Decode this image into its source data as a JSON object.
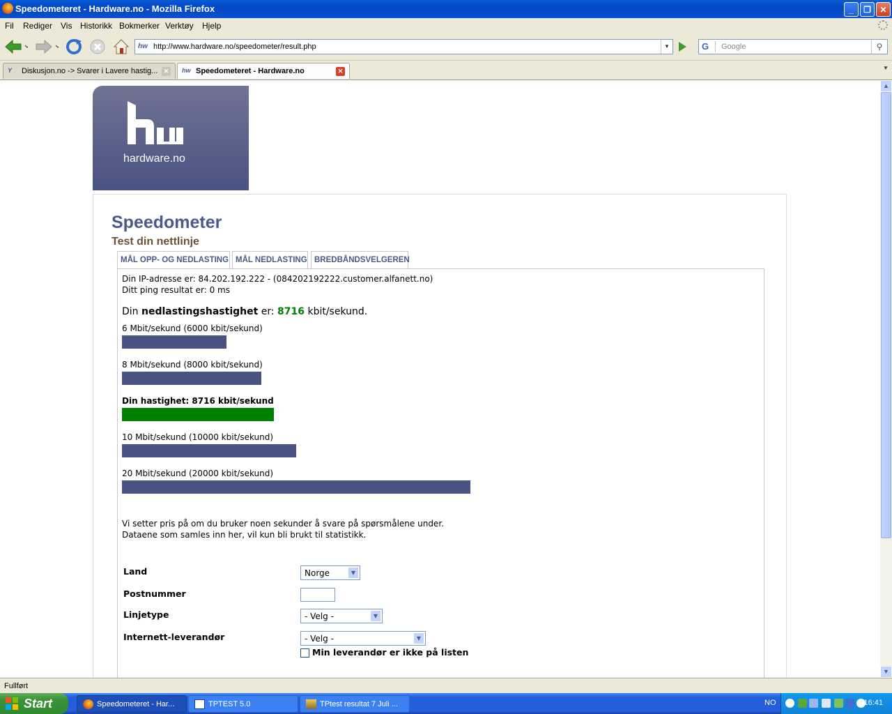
{
  "window": {
    "title": "Speedometeret - Hardware.no - Mozilla Firefox"
  },
  "menu": [
    "Fil",
    "Rediger",
    "Vis",
    "Historikk",
    "Bokmerker",
    "Verktøy",
    "Hjelp"
  ],
  "toolbar": {
    "url": "http://www.hardware.no/speedometer/result.php",
    "search_placeholder": "Google"
  },
  "tabs": [
    {
      "label": "Diskusjon.no -> Svarer i Lavere hastig...",
      "active": false
    },
    {
      "label": "Speedometeret - Hardware.no",
      "active": true
    }
  ],
  "page": {
    "logo_text": "hardware.no",
    "title": "Speedometer",
    "subtitle": "Test din nettlinje",
    "content_tabs": [
      "MÅL OPP- OG NEDLASTING",
      "MÅL NEDLASTING",
      "BREDBÅNDSVELGEREN"
    ],
    "ip_line": "Din IP-adresse er: 84.202.192.222 - (084202192222.customer.alfanett.no)",
    "ping_line": "Ditt ping resultat er: 0 ms",
    "speed_prefix": "Din ",
    "speed_bold": "nedlastingshastighet",
    "speed_mid": " er: ",
    "speed_value": "8716",
    "speed_suffix": " kbit/sekund.",
    "bars": [
      {
        "label": "6 Mbit/sekund (6000 kbit/sekund)",
        "kbit": 6000,
        "highlight": false
      },
      {
        "label": "8 Mbit/sekund (8000 kbit/sekund)",
        "kbit": 8000,
        "highlight": false
      },
      {
        "label": "Din hastighet: 8716 kbit/sekund",
        "kbit": 8716,
        "highlight": true
      },
      {
        "label": "10 Mbit/sekund (10000 kbit/sekund)",
        "kbit": 10000,
        "highlight": false
      },
      {
        "label": "20 Mbit/sekund (20000 kbit/sekund)",
        "kbit": 20000,
        "highlight": false
      }
    ],
    "survey_line1": "Vi setter pris på om du bruker noen sekunder å svare på spørsmålene under.",
    "survey_line2": "Dataene som samles inn her, vil kun bli brukt til statistikk.",
    "form": {
      "land_label": "Land",
      "land_value": "Norge",
      "postnummer_label": "Postnummer",
      "postnummer_value": "",
      "linjetype_label": "Linjetype",
      "linjetype_value": "- Velg -",
      "leverandor_label": "Internett-leverandør",
      "leverandor_value": "- Velg -",
      "checkbox_label": "Min leverandør er ikke på listen",
      "checkbox_checked": false
    }
  },
  "status": "Fullført",
  "taskbar": {
    "start": "Start",
    "tasks": [
      {
        "label": "Speedometeret - Har...",
        "active": true
      },
      {
        "label": "TPTEST 5.0",
        "active": false
      },
      {
        "label": "TPtest resultat 7 Juli ...",
        "active": false
      }
    ],
    "language": "NO",
    "clock": "16:41"
  },
  "colors": {
    "bar": "#4a5282",
    "bar_highlight": "#008000",
    "title": "#4a5a8a",
    "subtitle": "#6a5238"
  }
}
